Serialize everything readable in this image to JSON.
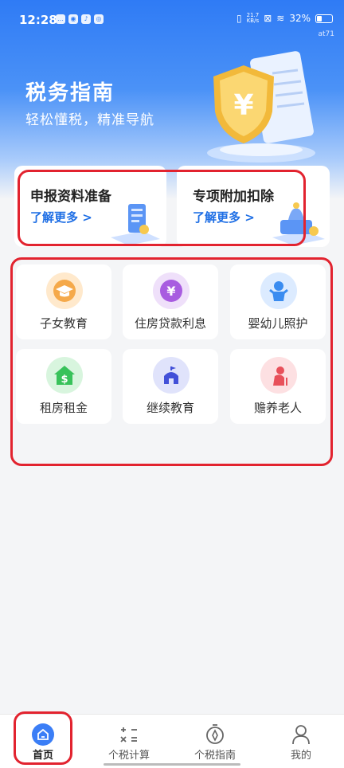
{
  "status_bar": {
    "time": "12:28",
    "net_speed_top": "21.7",
    "net_speed_bottom": "KB/s",
    "battery": "32%",
    "tag": "at71"
  },
  "hero": {
    "title": "税务指南",
    "subtitle": "轻松懂税，精准导航"
  },
  "cards": [
    {
      "title": "申报资料准备",
      "link": "了解更多 >"
    },
    {
      "title": "专项附加扣除",
      "link": "了解更多 >"
    }
  ],
  "categories": [
    {
      "label": "子女教育",
      "icon": "graduation-cap-icon",
      "color": "#f5a94a"
    },
    {
      "label": "住房贷款利息",
      "icon": "yuan-coin-icon",
      "color": "#a85ce0"
    },
    {
      "label": "婴幼儿照护",
      "icon": "baby-icon",
      "color": "#3a8cf0"
    },
    {
      "label": "租房租金",
      "icon": "house-dollar-icon",
      "color": "#38c25a"
    },
    {
      "label": "继续教育",
      "icon": "school-icon",
      "color": "#4250d8"
    },
    {
      "label": "赡养老人",
      "icon": "elder-icon",
      "color": "#e8505a"
    }
  ],
  "tabs": [
    {
      "label": "首页",
      "icon": "home-icon",
      "active": true
    },
    {
      "label": "个税计算",
      "icon": "calculator-icon",
      "active": false
    },
    {
      "label": "个税指南",
      "icon": "compass-icon",
      "active": false
    },
    {
      "label": "我的",
      "icon": "user-icon",
      "active": false
    }
  ],
  "colors": {
    "primary": "#2f7bf5",
    "link": "#1f6fe5",
    "highlight": "#e2232f"
  }
}
